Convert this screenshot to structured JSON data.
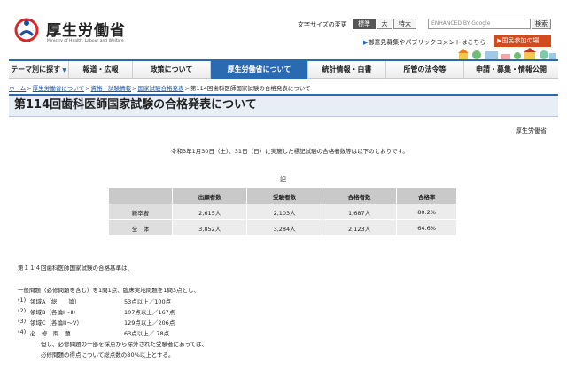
{
  "header": {
    "logo_title": "厚生労働省",
    "logo_subtitle": "Ministry of Health, Labour and Welfare",
    "font_size_label": "文字サイズの変更",
    "font_sizes": [
      "標準",
      "大",
      "特大"
    ],
    "search_placeholder": "ENHANCED BY Google",
    "search_button": "検索",
    "opinion_link": "御意見募集やパブリックコメントはこちら",
    "kokumin_button": "国民参加の場",
    "brand_color": "#2a6ab0"
  },
  "nav": {
    "items": [
      {
        "label": "テーマ別に探す",
        "arrow": "▼"
      },
      {
        "label": "報道・広報"
      },
      {
        "label": "政策について"
      },
      {
        "label": "厚生労働省について"
      },
      {
        "label": "統計情報・白書"
      },
      {
        "label": "所管の法令等"
      },
      {
        "label": "申請・募集・情報公開"
      }
    ],
    "active_index": 3
  },
  "breadcrumb": {
    "links": [
      "ホーム",
      "厚生労働省について",
      "資格・試験情報",
      "国家試験合格発表"
    ],
    "current": "第114回歯科医師国家試験の合格発表について",
    "separator": ">"
  },
  "page": {
    "title": "第114回歯科医師国家試験の合格発表について",
    "organization": "厚生労働省",
    "intro": "令和3年1月30日（土）、31日（日）に実施した標記試験の合格者数等は以下のとおりです。",
    "ki": "記"
  },
  "table": {
    "headers": [
      "",
      "出願者数",
      "受験者数",
      "合格者数",
      "合格率"
    ],
    "rows": [
      {
        "label": "新卒者",
        "cells": [
          "2,615人",
          "2,103人",
          "1,687人",
          "80.2%"
        ]
      },
      {
        "label": "全　体",
        "cells": [
          "3,852人",
          "3,284人",
          "2,123人",
          "64.6%"
        ]
      }
    ]
  },
  "criteria": {
    "heading": "第１１４回歯科医師国家試験の合格基準は、",
    "general": "一般問題（必修問題を含む）を1問1点、臨床実地問題を1問3点とし、",
    "items": [
      {
        "num": "(1)",
        "name": "領域A（総　　論）",
        "value": "53点以上／100点"
      },
      {
        "num": "(2)",
        "name": "領域B（各論Ⅰ～Ⅱ）",
        "value": "107点以上／167点"
      },
      {
        "num": "(3)",
        "name": "領域C（各論Ⅲ～Ⅴ）",
        "value": "129点以上／206点"
      },
      {
        "num": "(4)",
        "name": "必　修　問　題",
        "value": "63点以上／ 78点"
      }
    ],
    "note_line1": "但し、必修問題の一部を採点から除外された受験者にあっては、",
    "note_line2": "必修問題の得点について総点数の80%以上とする。"
  }
}
